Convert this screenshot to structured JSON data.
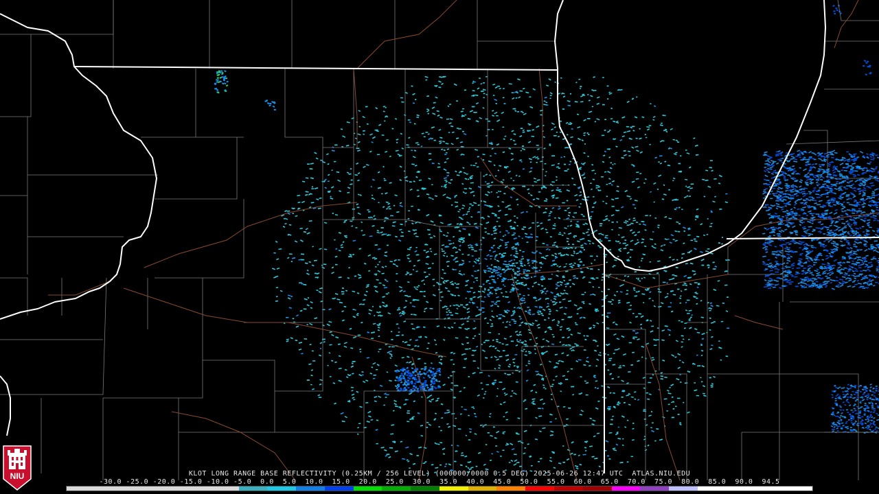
{
  "product": {
    "title": "KLOT LONG RANGE BASE REFLECTIVITY (0.25KM / 256 LEVEL) (000000/0000 0.5 DEG) 2025-06-26 12:47 UTC  ATLAS.NIU.EDU"
  },
  "legend": {
    "scale_text": "-30.0 -25.0 -20.0 -15.0 -10.0 -5.0  0.0  5.0  10.0  15.0  20.0  25.0  30.0  35.0  40.0  45.0  50.0  55.0  60.0  65.0  70.0  75.0  80.0  85.0  90.0  94.5",
    "color_stops": [
      "#d8d8d8",
      "#d8d8d8",
      "#d8d8d8",
      "#d8d8d8",
      "#d8d8d8",
      "#d8d8d8",
      "#3ab0c0",
      "#20c8e8",
      "#1080e8",
      "#0040f0",
      "#00e000",
      "#00b000",
      "#008000",
      "#f0f000",
      "#e0b000",
      "#ff8000",
      "#ff0000",
      "#c00000",
      "#a00000",
      "#ff00ff",
      "#9040c0",
      "#c0c0ff",
      "#ffffff",
      "#ffffff",
      "#ffffff",
      "#ffffff"
    ]
  },
  "logo": {
    "text": "NIU",
    "colors": {
      "bg": "#c8102e",
      "fg": "#ffffff"
    }
  },
  "colors": {
    "state_border": "#ffffff",
    "county_border": "#7a7a7a",
    "highway": "#8a4a30",
    "echo_light": "#2ec8d8",
    "echo_mid": "#1a90e8",
    "echo_strong": "#0050e0",
    "echo_green": "#30d060"
  }
}
